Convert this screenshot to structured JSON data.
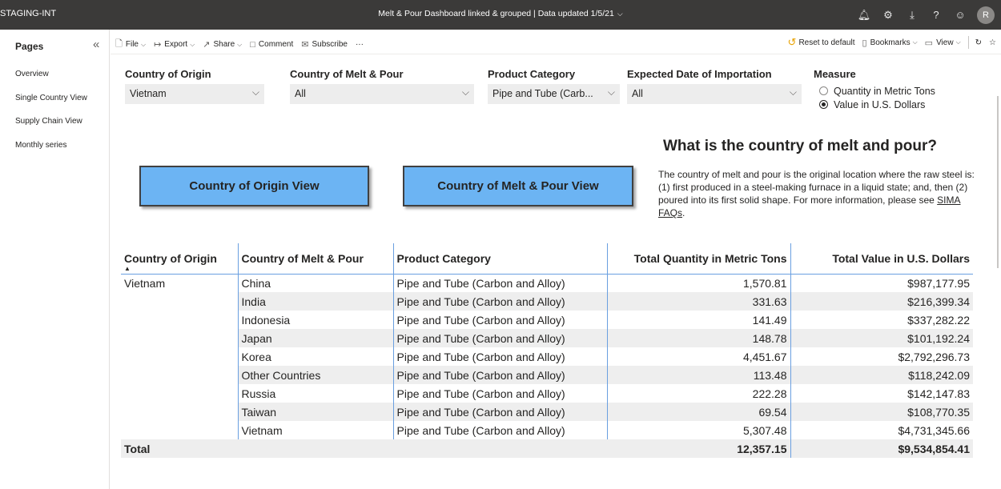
{
  "topbar": {
    "workspace": "STAGING-INT",
    "title": "Melt & Pour Dashboard linked & grouped  |  Data updated 1/5/21",
    "avatar_letter": "R",
    "icons": [
      "bell-icon",
      "gear-icon",
      "download-icon",
      "help-icon",
      "smiley-icon"
    ]
  },
  "pages": {
    "heading": "Pages",
    "items": [
      "Overview",
      "Single Country View",
      "Supply Chain View",
      "Monthly series"
    ]
  },
  "actionbar": {
    "file": "File",
    "export": "Export",
    "share": "Share",
    "comment": "Comment",
    "subscribe": "Subscribe",
    "more": "···",
    "reset": "Reset to default",
    "bookmarks": "Bookmarks",
    "view": "View"
  },
  "filters": {
    "origin": {
      "label": "Country of Origin",
      "value": "Vietnam"
    },
    "melt": {
      "label": "Country of Melt & Pour",
      "value": "All"
    },
    "product": {
      "label": "Product Category",
      "value": "Pipe and Tube (Carb..."
    },
    "date": {
      "label": "Expected Date of Importation",
      "value": "All"
    },
    "measure": {
      "label": "Measure",
      "options": [
        "Quantity in Metric Tons",
        "Value in U.S. Dollars"
      ],
      "selected": "Value in U.S. Dollars"
    }
  },
  "buttons": {
    "origin_view": "Country of Origin View",
    "melt_view": "Country of Melt & Pour View"
  },
  "info": {
    "title": "What is the country of melt and pour?",
    "text": "The country of melt and pour is the original location where the raw steel is: (1) first produced in a steel-making furnace in a liquid state; and, then (2) poured into its first solid shape. For more information, please see ",
    "link": "SIMA FAQs",
    "end": "."
  },
  "table": {
    "headers": [
      "Country of Origin",
      "Country of Melt & Pour",
      "Product Category",
      "Total Quantity in Metric Tons",
      "Total Value in U.S. Dollars"
    ],
    "rows": [
      [
        "Vietnam",
        "China",
        "Pipe and Tube (Carbon and Alloy)",
        "1,570.81",
        "$987,177.95"
      ],
      [
        "",
        "India",
        "Pipe and Tube (Carbon and Alloy)",
        "331.63",
        "$216,399.34"
      ],
      [
        "",
        "Indonesia",
        "Pipe and Tube (Carbon and Alloy)",
        "141.49",
        "$337,282.22"
      ],
      [
        "",
        "Japan",
        "Pipe and Tube (Carbon and Alloy)",
        "148.78",
        "$101,192.24"
      ],
      [
        "",
        "Korea",
        "Pipe and Tube (Carbon and Alloy)",
        "4,451.67",
        "$2,792,296.73"
      ],
      [
        "",
        "Other Countries",
        "Pipe and Tube (Carbon and Alloy)",
        "113.48",
        "$118,242.09"
      ],
      [
        "",
        "Russia",
        "Pipe and Tube (Carbon and Alloy)",
        "222.28",
        "$142,147.83"
      ],
      [
        "",
        "Taiwan",
        "Pipe and Tube (Carbon and Alloy)",
        "69.54",
        "$108,770.35"
      ],
      [
        "",
        "Vietnam",
        "Pipe and Tube (Carbon and Alloy)",
        "5,307.48",
        "$4,731,345.66"
      ]
    ],
    "total": {
      "label": "Total",
      "quantity": "12,357.15",
      "value": "$9,534,854.41"
    }
  }
}
